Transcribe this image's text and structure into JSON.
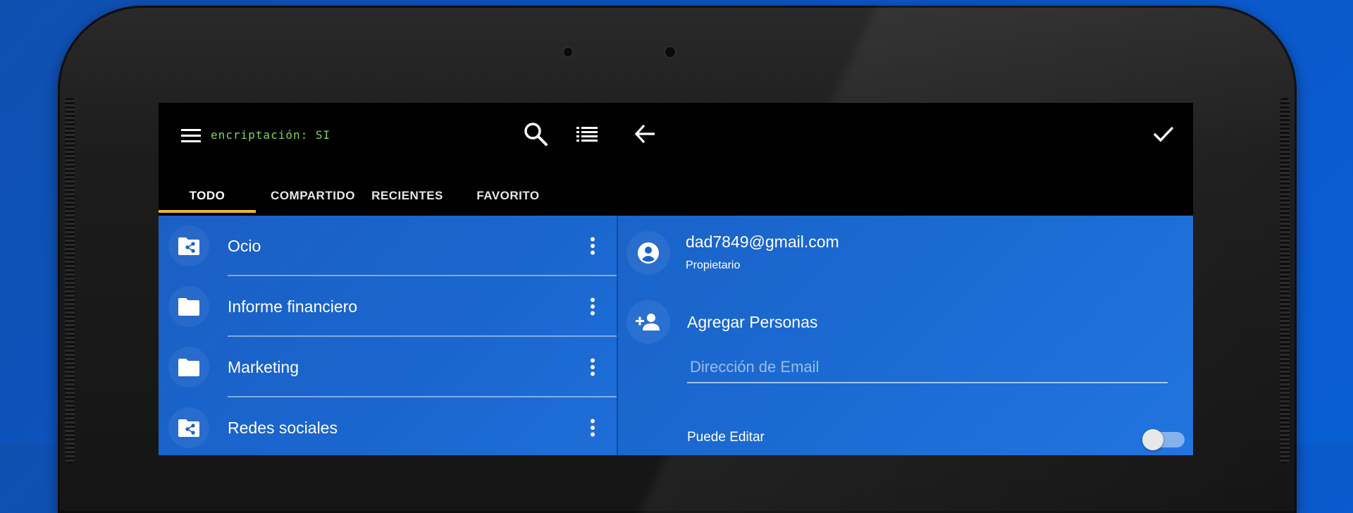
{
  "toolbar": {
    "encryption_label": "encriptación: SI",
    "icons": [
      "menu-icon",
      "search-icon",
      "list-icon",
      "back-icon",
      "check-icon"
    ]
  },
  "tabs": [
    {
      "label": "TODO",
      "active": true
    },
    {
      "label": "COMPARTIDO",
      "active": false
    },
    {
      "label": "RECIENTES",
      "active": false
    },
    {
      "label": "FAVORITO",
      "active": false
    }
  ],
  "folders": [
    {
      "label": "Ocio",
      "icon": "shared-folder-icon"
    },
    {
      "label": "Informe financiero",
      "icon": "folder-icon"
    },
    {
      "label": "Marketing",
      "icon": "folder-icon"
    },
    {
      "label": "Redes sociales",
      "icon": "shared-folder-icon"
    }
  ],
  "share": {
    "owner_email": "dad7849@gmail.com",
    "owner_role": "Propietario",
    "add_people_label": "Agregar Personas",
    "email_placeholder": "Dirección de Email",
    "email_value": "",
    "can_edit_label": "Puede Editar",
    "can_edit": false
  },
  "colors": {
    "accent_underline": "#f0b82e",
    "encryption_text": "#7ed85a",
    "pane_blue": "#1b66cf"
  }
}
